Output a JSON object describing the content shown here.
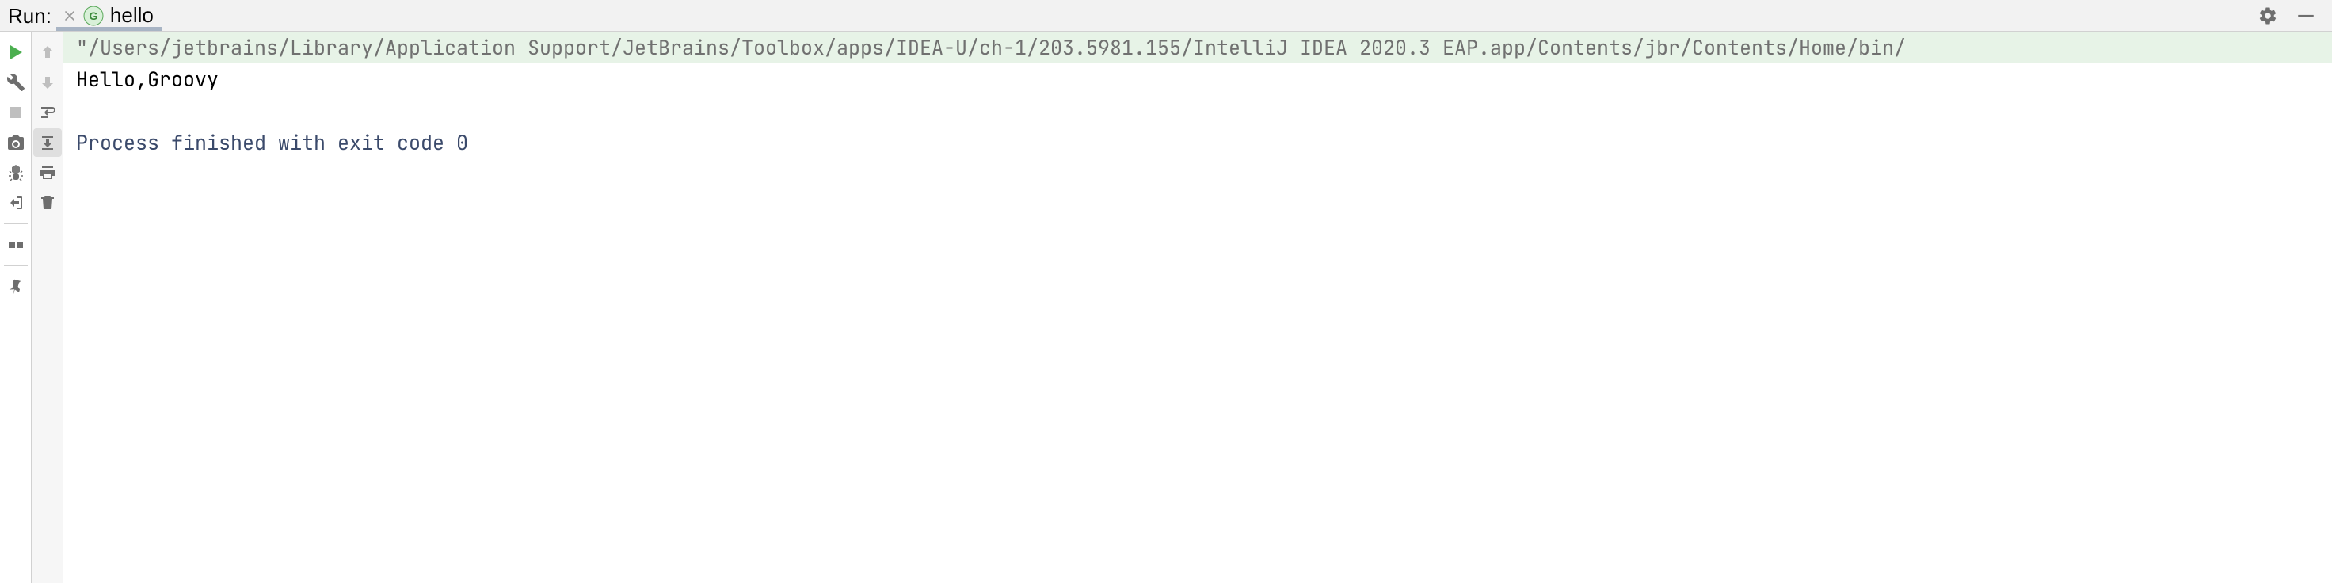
{
  "header": {
    "title": "Run:",
    "tab": {
      "close_icon": "close-icon",
      "lang_icon": "groovy-icon",
      "lang_letter": "G",
      "label": "hello"
    },
    "settings_icon": "gear-icon",
    "hide_icon": "minimize-icon"
  },
  "left_gutter": {
    "rerun": "run-icon",
    "build": "wrench-icon",
    "stop": "stop-icon",
    "dump": "camera-icon",
    "debugger": "debugger-icon",
    "exit": "exit-icon",
    "layout": "layout-icon",
    "pin": "pin-icon"
  },
  "secondary_gutter": {
    "up": "arrow-up-icon",
    "down": "arrow-down-icon",
    "softwrap": "softwrap-icon",
    "scroll_end": "scroll-to-end-icon",
    "print": "print-icon",
    "clear": "trash-icon"
  },
  "console": {
    "cmd": "\"/Users/jetbrains/Library/Application Support/JetBrains/Toolbox/apps/IDEA-U/ch-1/203.5981.155/IntelliJ IDEA 2020.3 EAP.app/Contents/jbr/Contents/Home/bin/",
    "out": "Hello,Groovy",
    "finish": "Process finished with exit code 0"
  }
}
